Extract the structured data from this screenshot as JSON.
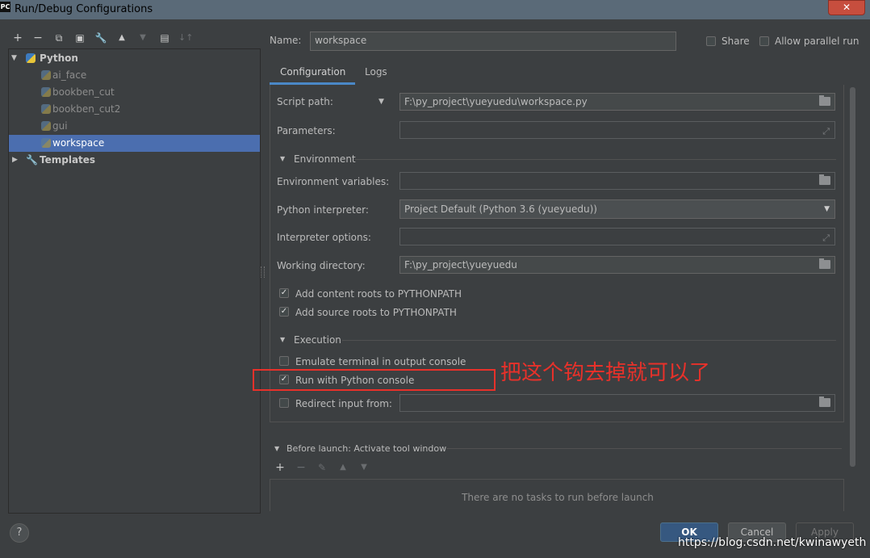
{
  "window": {
    "title": "Run/Debug Configurations",
    "app_icon": "PC",
    "close_glyph": "✕"
  },
  "toolbar": {
    "add": "+",
    "remove": "−",
    "copy": "⧉",
    "save": "▣",
    "edit_defaults": "🔧",
    "move_up": "▲",
    "move_down": "▼",
    "folder": "▤",
    "sort": "↓↑"
  },
  "tree": {
    "python_label": "Python",
    "items": [
      "ai_face",
      "bookben_cut",
      "bookben_cut2",
      "gui",
      "workspace"
    ],
    "selected": "workspace",
    "templates_label": "Templates"
  },
  "header": {
    "name_label": "Name:",
    "name_value": "workspace",
    "share_label": "Share",
    "allow_parallel_label": "Allow parallel run"
  },
  "tabs": [
    "Configuration",
    "Logs"
  ],
  "config": {
    "script_path_label": "Script path:",
    "script_path_value": "F:\\py_project\\yueyuedu\\workspace.py",
    "parameters_label": "Parameters:",
    "environment_section": "Environment",
    "env_vars_label": "Environment variables:",
    "interpreter_label": "Python interpreter:",
    "interpreter_value": "Project Default (Python 3.6 (yueyuedu))",
    "interp_options_label": "Interpreter options:",
    "working_dir_label": "Working directory:",
    "working_dir_value": "F:\\py_project\\yueyuedu",
    "add_content_roots": "Add content roots to PYTHONPATH",
    "add_source_roots": "Add source roots to PYTHONPATH",
    "execution_section": "Execution",
    "emulate_terminal": "Emulate terminal in output console",
    "run_with_console": "Run with Python console",
    "redirect_input": "Redirect input from:"
  },
  "annotation": {
    "text": "把这个钩去掉就可以了",
    "color": "#e8312a"
  },
  "before_launch": {
    "title": "Before launch: Activate tool window",
    "add": "+",
    "remove": "−",
    "edit": "✎",
    "up": "▲",
    "down": "▼",
    "empty_text": "There are no tasks to run before launch"
  },
  "footer": {
    "help": "?",
    "ok": "OK",
    "cancel": "Cancel",
    "apply": "Apply",
    "watermark": "https://blog.csdn.net/kwinawyeth"
  },
  "colors": {
    "background": "#3c3f41",
    "selection": "#4b6eaf",
    "ok_button": "#365880"
  }
}
